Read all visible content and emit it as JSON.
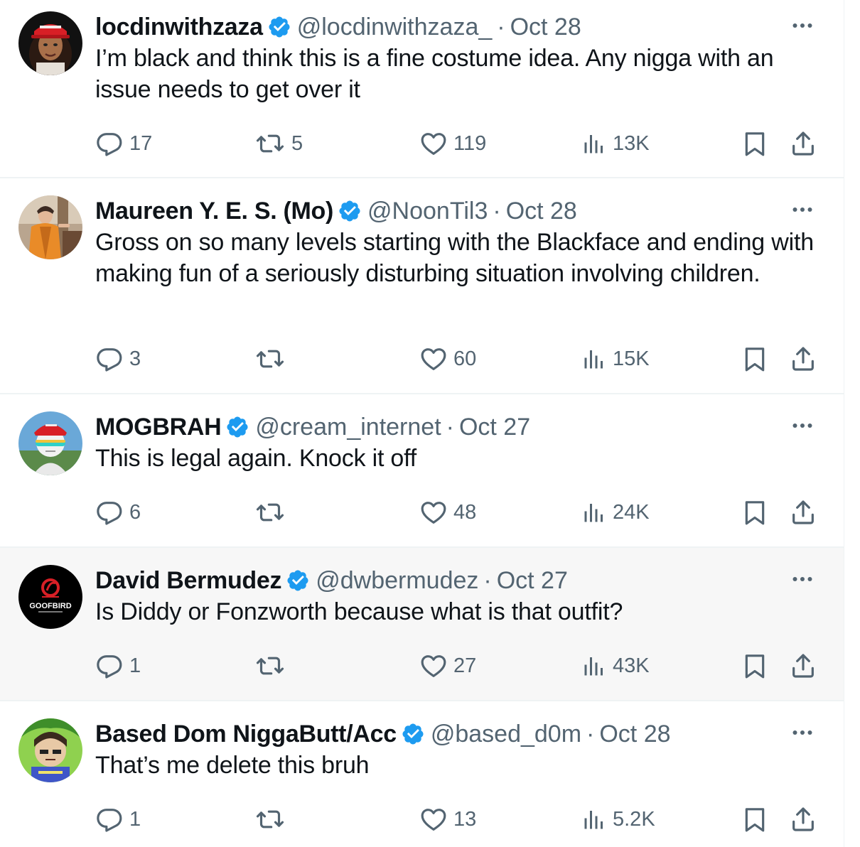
{
  "tweets": [
    {
      "name": "locdinwithzaza",
      "handle": "@locdinwithzaza_",
      "date": "Oct 28",
      "text": "I’m black and think this is a fine costume idea. Any nigga with an issue needs to get over it",
      "replies": "17",
      "retweets": "5",
      "likes": "119",
      "views": "13K"
    },
    {
      "name": "Maureen Y. E. S. (Mo)",
      "handle": "@NoonTil3",
      "date": "Oct 28",
      "text": "Gross on so many levels starting with the Blackface and ending with making fun of a seriously disturbing situation involving children.",
      "replies": "3",
      "retweets": "",
      "likes": "60",
      "views": "15K"
    },
    {
      "name": "MOGBRAH",
      "handle": "@cream_internet",
      "date": "Oct 27",
      "text": "This is legal again. Knock it off",
      "replies": "6",
      "retweets": "",
      "likes": "48",
      "views": "24K"
    },
    {
      "name": "David Bermudez",
      "handle": "@dwbermudez",
      "date": "Oct 27",
      "text": "Is Diddy or Fonzworth because what is that outfit?",
      "replies": "1",
      "retweets": "",
      "likes": "27",
      "views": "43K",
      "avatar_text": "GOOFBIRD"
    },
    {
      "name": "Based Dom NiggaButt/Acc",
      "handle": "@based_d0m",
      "date": "Oct 28",
      "text": "That’s me delete this bruh",
      "replies": "1",
      "retweets": "",
      "likes": "13",
      "views": "5.2K"
    }
  ],
  "separator": "·",
  "icons": {
    "verified": "verified-badge-icon",
    "more": "more-icon",
    "reply": "reply-icon",
    "retweet": "retweet-icon",
    "like": "like-icon",
    "views": "views-icon",
    "bookmark": "bookmark-icon",
    "share": "share-icon"
  },
  "colors": {
    "verified": "#1d9bf0",
    "text": "#0f1419",
    "muted": "#536471",
    "hover_bg": "#f7f7f7",
    "divider": "#eff3f4"
  }
}
